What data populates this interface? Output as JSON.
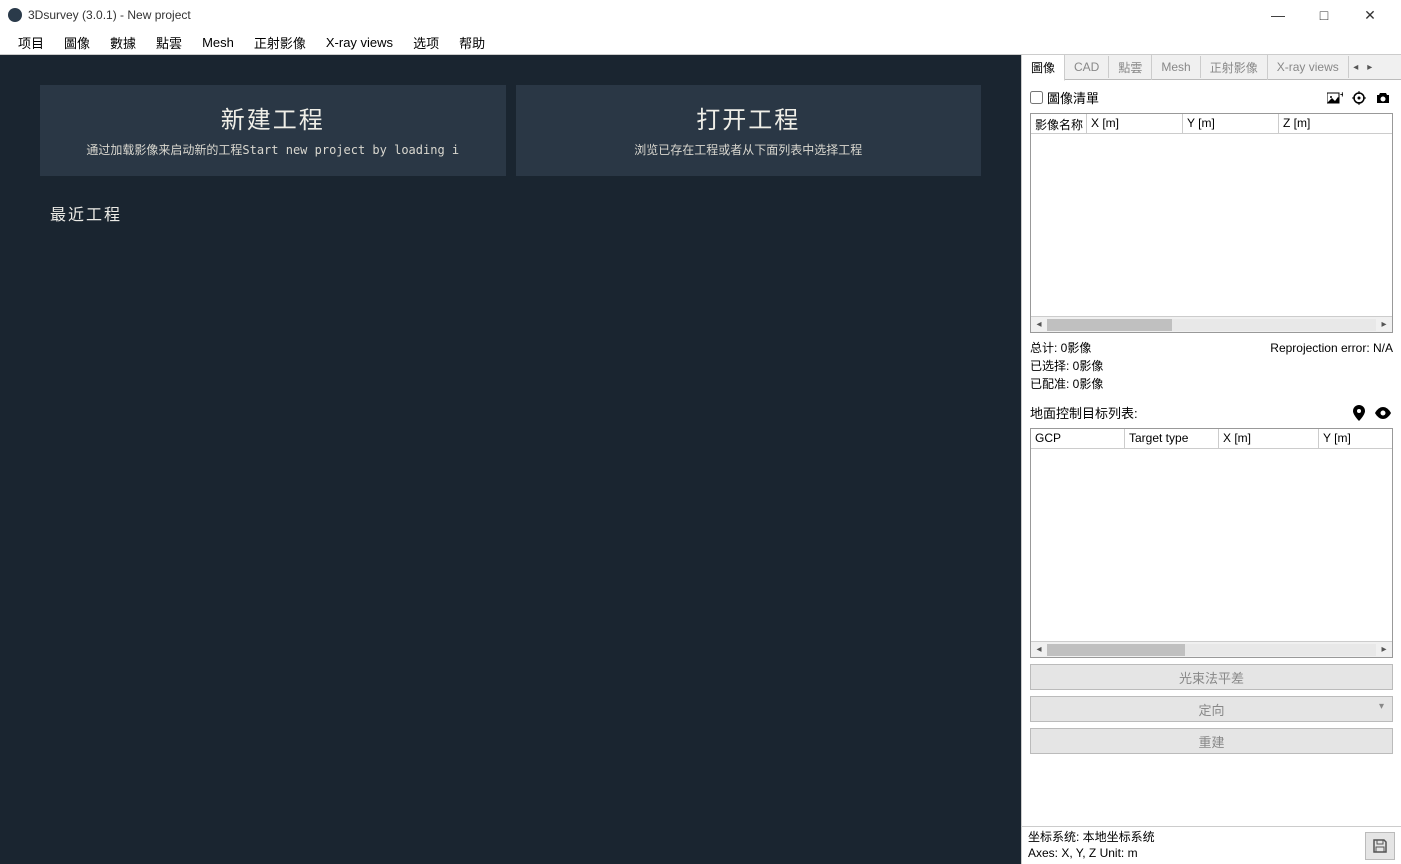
{
  "titlebar": {
    "title": "3Dsurvey (3.0.1) - New project"
  },
  "menu": [
    "项目",
    "圖像",
    "數據",
    "點雲",
    "Mesh",
    "正射影像",
    "X-ray views",
    "选项",
    "帮助"
  ],
  "start": {
    "new": {
      "title": "新建工程",
      "sub": "通过加载影像来启动新的工程Start new project by loading i"
    },
    "open": {
      "title": "打开工程",
      "sub": "浏览已存在工程或者从下面列表中选择工程"
    },
    "recent_label": "最近工程"
  },
  "side": {
    "tabs": [
      "圖像",
      "CAD",
      "點雲",
      "Mesh",
      "正射影像",
      "X-ray views"
    ],
    "active_tab_index": 0,
    "image_list": {
      "checkbox_label": "圖像清單",
      "headers": [
        "影像名称",
        "X [m]",
        "Y [m]",
        "Z [m]"
      ]
    },
    "stats": {
      "total": "总计: 0影像",
      "reproj": "Reprojection error: N/A",
      "selected": "已选择: 0影像",
      "registered": "已配准: 0影像"
    },
    "gcp": {
      "label": "地面控制目标列表:",
      "headers": [
        "GCP",
        "Target type",
        "X [m]",
        "Y [m]"
      ]
    },
    "buttons": {
      "bundle": "光束法平差",
      "orient": "定向",
      "reconstruct": "重建"
    }
  },
  "footer": {
    "line1": "坐标系统: 本地坐标系统",
    "line2": "Axes: X, Y, Z Unit: m"
  }
}
